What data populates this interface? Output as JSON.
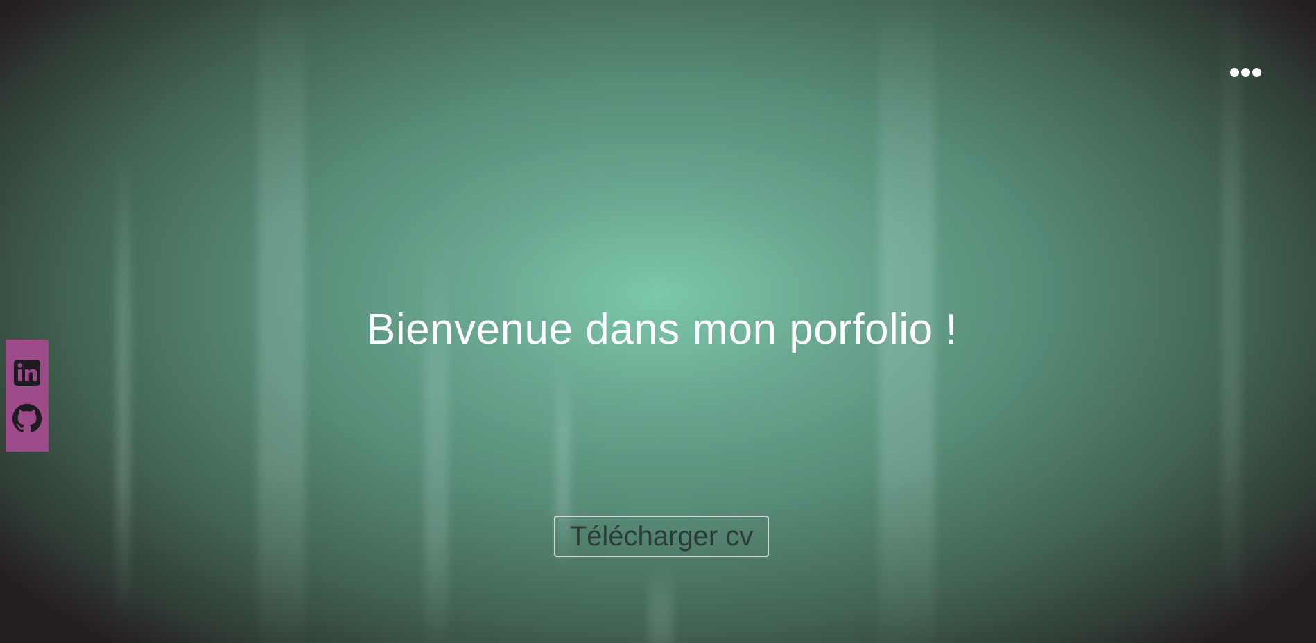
{
  "header": {
    "menu_icon": "more-horizontal-icon"
  },
  "social": {
    "background_color": "#9c4a88",
    "items": [
      {
        "icon": "linkedin-icon"
      },
      {
        "icon": "github-icon"
      }
    ]
  },
  "hero": {
    "title": "Bienvenue dans mon porfolio !",
    "cv_button_label": "Télécharger cv"
  },
  "colors": {
    "background_center": "#7cc8aa",
    "background_edge": "#261f22",
    "text": "#ffffff",
    "button_text": "#2c3d35"
  }
}
